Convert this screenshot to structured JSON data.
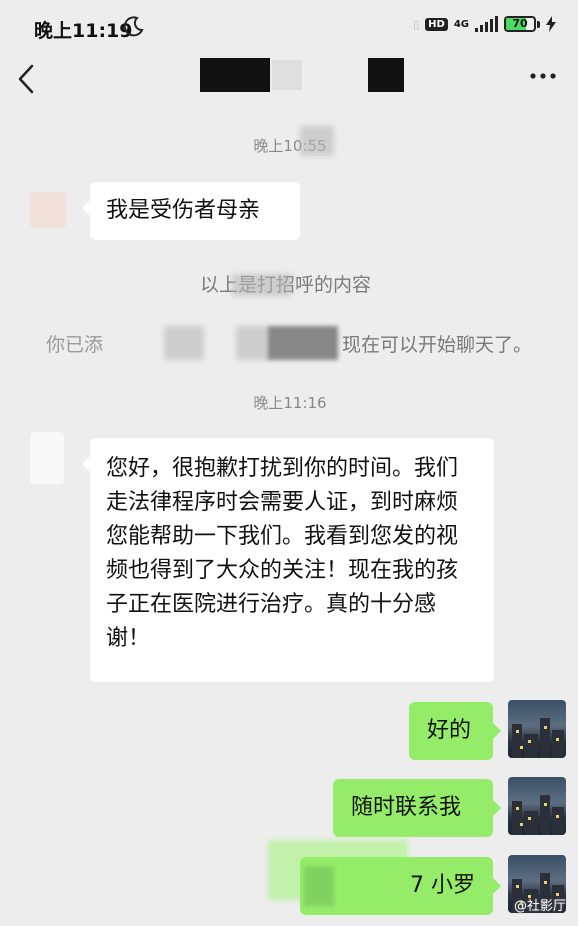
{
  "status_bar": {
    "time": "晚上11:19",
    "hd": "HD",
    "network": "4G",
    "battery_percent": 70,
    "battery_label": "70"
  },
  "chat": {
    "time_1": "晚上10:55",
    "time_2": "晚上11:16",
    "messages": [
      {
        "side": "left",
        "text": "我是受伤者母亲"
      },
      {
        "side": "left",
        "text": "您好，很抱歉打扰到你的时间。我们走法律程序时会需要人证，到时麻烦您能帮助一下我们。我看到您发的视频也得到了大众的关注！现在我的孩子正在医院进行治疗。真的十分感谢！"
      },
      {
        "side": "right",
        "text": "好的"
      },
      {
        "side": "right",
        "text": "随时联系我"
      },
      {
        "side": "right",
        "text": "7 小罗"
      }
    ],
    "system_1": "以上是打招呼的内容",
    "system_2_prefix": "你已添",
    "system_2_suffix": "现在可以开始聊天了。"
  },
  "watermark": "@社影厅",
  "colors": {
    "background": "#ededed",
    "bubble_sent": "#95ec69",
    "bubble_received": "#ffffff"
  }
}
